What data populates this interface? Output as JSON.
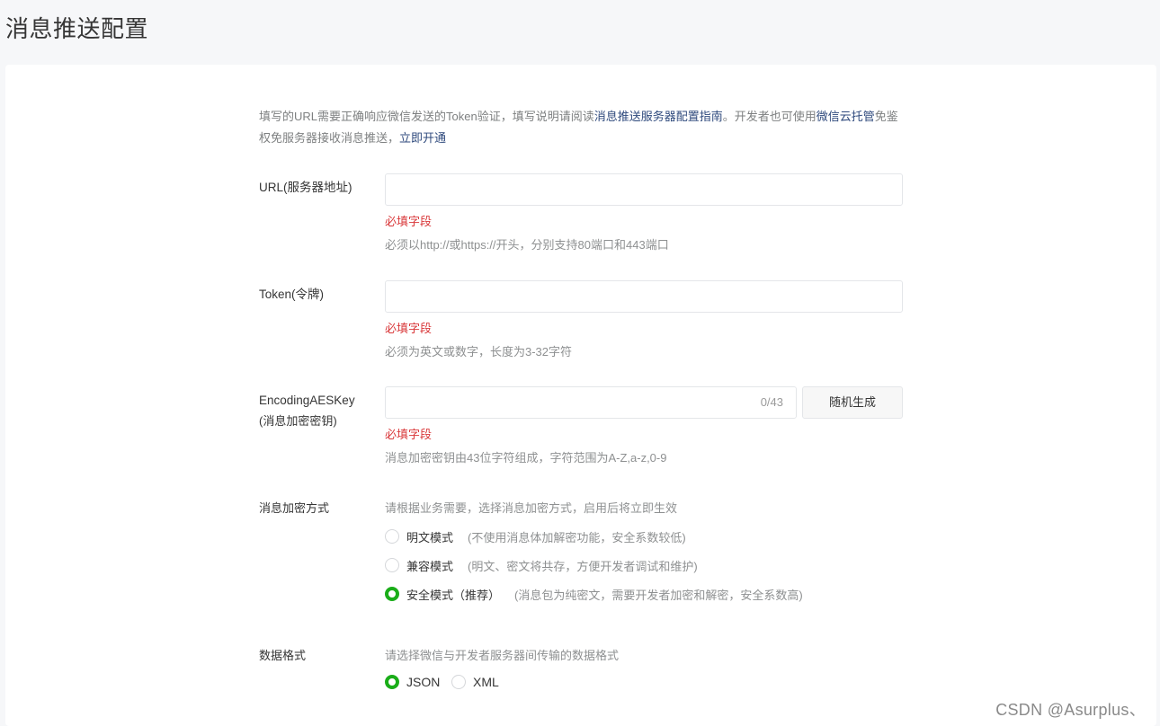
{
  "page": {
    "title": "消息推送配置"
  },
  "intro": {
    "text1": "填写的URL需要正确响应微信发送的Token验证，填写说明请阅读",
    "link1": "消息推送服务器配置指南",
    "text2": "。开发者也可使用",
    "link2": "微信云托管",
    "text3": "免鉴权免服务器接收消息推送，",
    "link3": "立即开通"
  },
  "url": {
    "label": "URL(服务器地址)",
    "value": "",
    "error": "必填字段",
    "hint": "必须以http://或https://开头，分别支持80端口和443端口"
  },
  "token": {
    "label": "Token(令牌)",
    "value": "",
    "error": "必填字段",
    "hint": "必须为英文或数字，长度为3-32字符"
  },
  "aeskey": {
    "label_line1": "EncodingAESKey",
    "label_line2": "(消息加密密钥)",
    "value": "",
    "counter": "0/43",
    "generate_button": "随机生成",
    "error": "必填字段",
    "hint": "消息加密密钥由43位字符组成，字符范围为A-Z,a-z,0-9"
  },
  "encryption": {
    "label": "消息加密方式",
    "hint": "请根据业务需要，选择消息加密方式，启用后将立即生效",
    "options": [
      {
        "label": "明文模式",
        "desc": "(不使用消息体加解密功能，安全系数较低)",
        "selected": false
      },
      {
        "label": "兼容模式",
        "desc": "(明文、密文将共存，方便开发者调试和维护)",
        "selected": false
      },
      {
        "label": "安全模式（推荐）",
        "desc": "(消息包为纯密文，需要开发者加密和解密，安全系数高)",
        "selected": true
      }
    ]
  },
  "format": {
    "label": "数据格式",
    "hint": "请选择微信与开发者服务器间传输的数据格式",
    "options": [
      {
        "label": "JSON",
        "selected": true
      },
      {
        "label": "XML",
        "selected": false
      }
    ]
  },
  "watermark": "CSDN @Asurplus、",
  "colors": {
    "accent": "#1aad19",
    "error": "#d9383a",
    "link": "#2f4a7d"
  }
}
